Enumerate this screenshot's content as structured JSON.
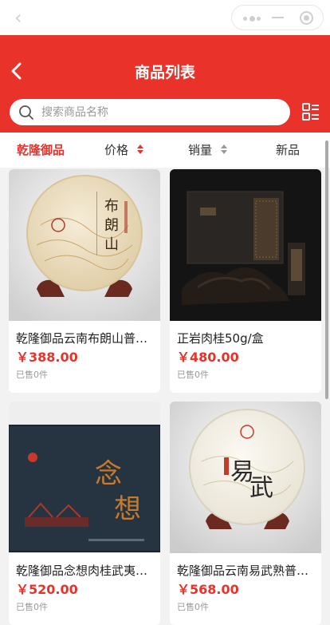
{
  "header": {
    "title": "商品列表"
  },
  "search": {
    "placeholder": "搜索商品名称"
  },
  "sort": {
    "tabs": [
      {
        "label": "乾隆御品"
      },
      {
        "label": "价格"
      },
      {
        "label": "销量"
      },
      {
        "label": "新品"
      }
    ]
  },
  "colors": {
    "brand": "#e8322a",
    "price": "#e8322a"
  },
  "products": [
    {
      "name": "乾隆御品云南布朗山普洱茶",
      "price": "￥388.00",
      "sold": "已售0件",
      "image_text": "布朗山"
    },
    {
      "name": "正岩肉桂50g/盒",
      "price": "￥480.00",
      "sold": "已售0件",
      "image_text": ""
    },
    {
      "name": "乾隆御品念想肉桂武夷岩茶",
      "price": "￥520.00",
      "sold": "已售0件",
      "image_text": "念想"
    },
    {
      "name": "乾隆御品云南易武熟普洱茶",
      "price": "￥568.00",
      "sold": "已售0件",
      "image_text": "易武"
    }
  ]
}
